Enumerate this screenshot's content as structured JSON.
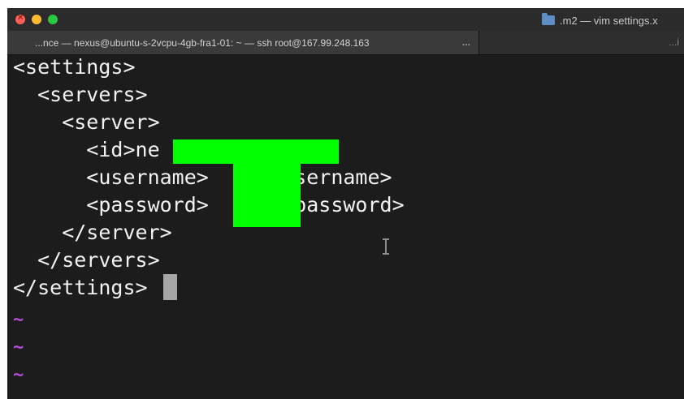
{
  "window": {
    "title": ".m2 — vim settings.x",
    "tabs": [
      {
        "label": "...nce — nexus@ubuntu-s-2vcpu-4gb-fra1-01: ~ — ssh root@167.99.248.163",
        "overflow": "..."
      },
      {
        "label": "...i"
      }
    ]
  },
  "editor": {
    "lines": [
      "<settings>",
      "  <servers>",
      "    <server>",
      "      <id>ne        s</id>",
      "      <username>     /username>",
      "      <password>     </password>",
      "    </server>",
      "  </servers>",
      "</settings>"
    ],
    "empty_line_markers": [
      "~",
      "~",
      "~",
      "~"
    ],
    "redaction_color": "#00ff00",
    "tilde_color": "#b44fd8",
    "cursor_color": "#a6a6a6"
  }
}
